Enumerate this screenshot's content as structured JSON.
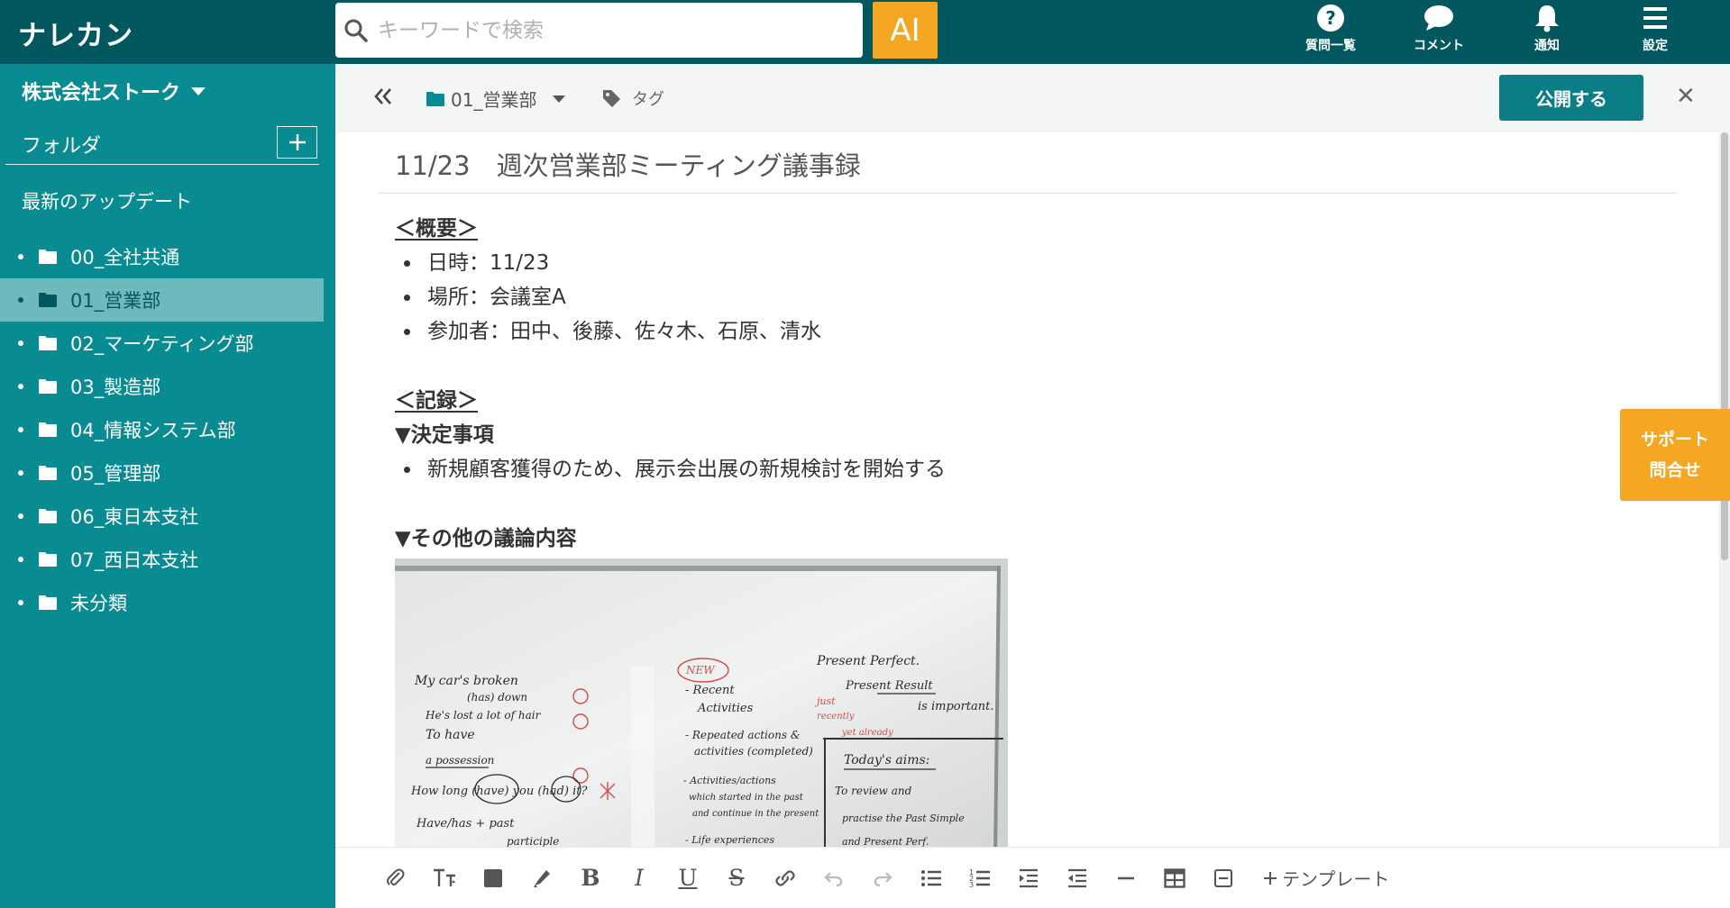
{
  "app": {
    "logo": "ナレカン"
  },
  "header": {
    "search_placeholder": "キーワードで検索",
    "ai_label": "AI",
    "nav": [
      {
        "label": "質問一覧",
        "icon": "question-icon"
      },
      {
        "label": "コメント",
        "icon": "comment-icon"
      },
      {
        "label": "通知",
        "icon": "bell-icon"
      },
      {
        "label": "設定",
        "icon": "menu-icon"
      }
    ]
  },
  "sidebar": {
    "company": "株式会社ストーク",
    "folder_heading": "フォルダ",
    "latest_updates": "最新のアップデート",
    "folders": [
      {
        "label": "00_全社共通"
      },
      {
        "label": "01_営業部"
      },
      {
        "label": "02_マーケティング部"
      },
      {
        "label": "03_製造部"
      },
      {
        "label": "04_情報システム部"
      },
      {
        "label": "05_管理部"
      },
      {
        "label": "06_東日本支社"
      },
      {
        "label": "07_西日本支社"
      },
      {
        "label": "未分類"
      }
    ],
    "active_folder": "01_営業部"
  },
  "editor": {
    "breadcrumb_folder": "01_営業部",
    "tag_label": "タグ",
    "publish_label": "公開する",
    "title": "11/23　週次営業部ミーティング議事録",
    "overview_heading": "＜概要＞",
    "overview_items": [
      "日時：11/23",
      "場所：会議室A",
      "参加者：田中、後藤、佐々木、石原、清水"
    ],
    "record_heading": "＜記録＞",
    "decisions_heading": "▼決定事項",
    "decision_items": [
      "新規顧客獲得のため、展示会出展の新規検討を開始する"
    ],
    "other_heading": "▼その他の議論内容",
    "whiteboard": {
      "left": [
        "My car's broken",
        "(has) down",
        "He's lost a lot of hair",
        "To have",
        "a possession",
        "How long (have) you (had) it?",
        "Have/has + past",
        "participle"
      ],
      "center": [
        "NEW",
        "- Recent",
        "Activities",
        "- Repeated actions &",
        "activities (completed)",
        "- Activities/actions",
        "which started in the past",
        "and continue in the present",
        "- Life experiences"
      ],
      "right": [
        "Present Perfect.",
        "Present Result",
        "is important.",
        "just",
        "recently",
        "yet already",
        "Today's aims:",
        "To review and",
        "practise the Past Simple",
        "and Present Perf."
      ]
    }
  },
  "support": {
    "line1": "サポート",
    "line2": "問合せ"
  },
  "toolbar": {
    "template_label": "テンプレート",
    "buttons": [
      "attach-icon",
      "text-size-icon",
      "text-color-icon",
      "highlight-icon",
      "bold-icon",
      "italic-icon",
      "underline-icon",
      "strikethrough-icon",
      "link-icon",
      "undo-icon",
      "redo-icon",
      "bullet-list-icon",
      "numbered-list-icon",
      "indent-icon",
      "outdent-icon",
      "horizontal-rule-icon",
      "table-icon",
      "collapse-block-icon"
    ]
  }
}
